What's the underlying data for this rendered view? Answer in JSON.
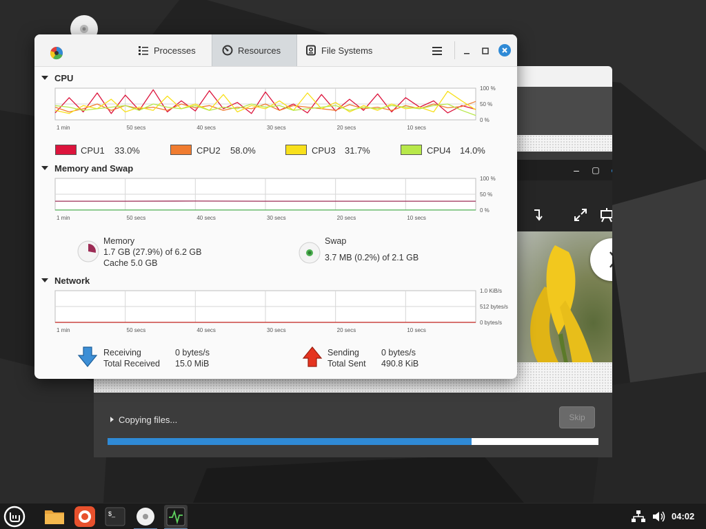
{
  "sysmon": {
    "tabs": [
      {
        "label": "Processes"
      },
      {
        "label": "Resources"
      },
      {
        "label": "File Systems"
      }
    ],
    "cpu": {
      "title": "CPU",
      "legend": [
        {
          "name": "CPU1",
          "value": "33.0%",
          "color": "#dc143c"
        },
        {
          "name": "CPU2",
          "value": "58.0%",
          "color": "#f07c30"
        },
        {
          "name": "CPU3",
          "value": "31.7%",
          "color": "#f8e01c"
        },
        {
          "name": "CPU4",
          "value": "14.0%",
          "color": "#b8e84a"
        }
      ]
    },
    "memory": {
      "title": "Memory and Swap",
      "memory_label": "Memory",
      "memory_value": "1.7 GB (27.9%) of 6.2 GB",
      "cache_value": "Cache 5.0 GB",
      "memory_fraction": 0.279,
      "swap_label": "Swap",
      "swap_value": "3.7 MB (0.2%) of 2.1 GB",
      "swap_fraction": 0.002
    },
    "network": {
      "title": "Network",
      "receiving_label": "Receiving",
      "receiving_value": "0 bytes/s",
      "total_received_label": "Total Received",
      "total_received_value": "15.0 MiB",
      "sending_label": "Sending",
      "sending_value": "0 bytes/s",
      "total_sent_label": "Total Sent",
      "total_sent_value": "490.8 KiB"
    }
  },
  "installer": {
    "status": "Copying files...",
    "skip_label": "Skip",
    "progress": 0.742
  },
  "taskbar": {
    "clock": "04:02"
  },
  "chart_data": [
    {
      "type": "line",
      "title": "CPU",
      "x_tick_labels": [
        "1 min",
        "50 secs",
        "40 secs",
        "30 secs",
        "20 secs",
        "10 secs"
      ],
      "y_tick_labels": [
        "100 %",
        "50 %",
        "0 %"
      ],
      "ylim": [
        0,
        100
      ],
      "x": [
        60,
        58,
        56,
        54,
        52,
        50,
        48,
        46,
        44,
        42,
        40,
        38,
        36,
        34,
        32,
        30,
        28,
        26,
        24,
        22,
        20,
        18,
        16,
        14,
        12,
        10,
        8,
        6,
        4,
        2,
        0
      ],
      "series": [
        {
          "name": "CPU1",
          "color": "#dc143c",
          "values": [
            22,
            70,
            25,
            85,
            20,
            78,
            30,
            95,
            25,
            60,
            28,
            92,
            35,
            55,
            20,
            88,
            30,
            50,
            22,
            80,
            28,
            65,
            30,
            82,
            25,
            70,
            40,
            60,
            22,
            45,
            33
          ]
        },
        {
          "name": "CPU2",
          "color": "#f07c30",
          "values": [
            40,
            25,
            35,
            50,
            30,
            45,
            35,
            40,
            30,
            50,
            38,
            45,
            30,
            40,
            35,
            50,
            30,
            45,
            40,
            35,
            30,
            48,
            35,
            40,
            30,
            45,
            35,
            50,
            38,
            42,
            58
          ]
        },
        {
          "name": "CPU3",
          "color": "#f8e01c",
          "values": [
            30,
            20,
            45,
            35,
            65,
            25,
            40,
            30,
            75,
            35,
            50,
            30,
            80,
            25,
            45,
            35,
            60,
            30,
            85,
            35,
            55,
            25,
            45,
            30,
            50,
            35,
            40,
            25,
            90,
            60,
            31.7
          ]
        },
        {
          "name": "CPU4",
          "color": "#b8e84a",
          "values": [
            45,
            40,
            30,
            35,
            40,
            45,
            30,
            50,
            40,
            35,
            45,
            30,
            40,
            35,
            50,
            40,
            45,
            30,
            35,
            40,
            45,
            30,
            40,
            35,
            45,
            40,
            35,
            45,
            50,
            30,
            14
          ]
        }
      ]
    },
    {
      "type": "line",
      "title": "Memory and Swap",
      "x_tick_labels": [
        "1 min",
        "50 secs",
        "40 secs",
        "30 secs",
        "20 secs",
        "10 secs"
      ],
      "y_tick_labels": [
        "100 %",
        "50 %",
        "0 %"
      ],
      "ylim": [
        0,
        100
      ],
      "x": [
        60,
        50,
        40,
        30,
        20,
        10,
        0
      ],
      "series": [
        {
          "name": "Memory",
          "color": "#9c2c55",
          "values": [
            28,
            28,
            28.5,
            28,
            28,
            28,
            28
          ]
        },
        {
          "name": "Swap",
          "color": "#4caf50",
          "values": [
            0.2,
            0.2,
            0.2,
            0.2,
            0.2,
            0.2,
            0.2
          ]
        }
      ]
    },
    {
      "type": "line",
      "title": "Network",
      "x_tick_labels": [
        "1 min",
        "50 secs",
        "40 secs",
        "30 secs",
        "20 secs",
        "10 secs"
      ],
      "y_tick_labels": [
        "1.0 KiB/s",
        "512 bytes/s",
        "0 bytes/s"
      ],
      "ylim": [
        0,
        1024
      ],
      "x": [
        60,
        0
      ],
      "series": [
        {
          "name": "Receiving",
          "color": "#2f8ad6",
          "values": [
            0,
            0
          ]
        },
        {
          "name": "Sending",
          "color": "#e03020",
          "values": [
            0,
            0
          ]
        }
      ]
    }
  ]
}
